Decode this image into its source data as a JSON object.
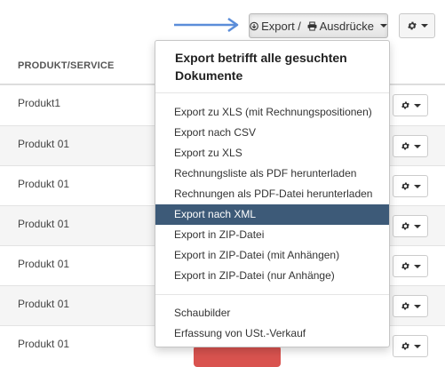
{
  "toolbar": {
    "export_label": "Export / ",
    "print_label": "Ausdrücke"
  },
  "table": {
    "column_header": "PRODUKT/SERVICE",
    "rows": [
      {
        "name": "Produkt1"
      },
      {
        "name": "Produkt 01"
      },
      {
        "name": "Produkt 01"
      },
      {
        "name": "Produkt 01"
      },
      {
        "name": "Produkt 01"
      },
      {
        "name": "Produkt 01"
      },
      {
        "name": "Produkt 01"
      }
    ]
  },
  "dropdown": {
    "heading": "Export betrifft alle gesuchten Dokumente",
    "export_items": [
      {
        "label": "Export zu XLS (mit Rechnungspositionen)",
        "active": false
      },
      {
        "label": "Export nach CSV",
        "active": false
      },
      {
        "label": "Export zu XLS",
        "active": false
      },
      {
        "label": "Rechnungsliste als PDF herunterladen",
        "active": false
      },
      {
        "label": "Rechnungen als PDF-Datei herunterladen",
        "active": false
      },
      {
        "label": "Export nach XML",
        "active": true
      },
      {
        "label": "Export in ZIP-Datei",
        "active": false
      },
      {
        "label": "Export in ZIP-Datei (mit Anhängen)",
        "active": false
      },
      {
        "label": "Export in ZIP-Datei (nur Anhänge)",
        "active": false
      }
    ],
    "other_items": [
      {
        "label": "Schaubilder"
      },
      {
        "label": "Erfassung von USt.-Verkauf"
      }
    ]
  },
  "colors": {
    "accent_arrow": "#5b8dd9",
    "active_item_bg": "#3d5a78",
    "delete_button": "#d9534f"
  },
  "icons": {
    "export": "circle-arrow-icon",
    "print": "printer-icon",
    "settings": "gear-icon",
    "dropdown": "caret-down-icon",
    "annotation": "arrow-right-icon"
  }
}
